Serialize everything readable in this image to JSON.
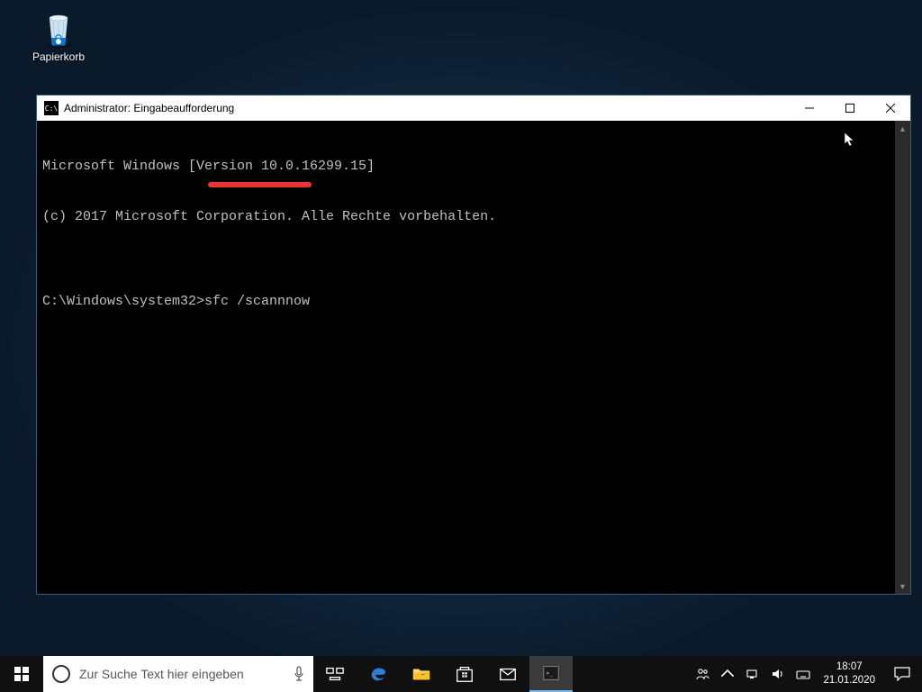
{
  "desktop": {
    "recycle_bin_label": "Papierkorb"
  },
  "cmd_window": {
    "title": "Administrator: Eingabeaufforderung",
    "lines": [
      "Microsoft Windows [Version 10.0.16299.15]",
      "(c) 2017 Microsoft Corporation. Alle Rechte vorbehalten.",
      "",
      "C:\\Windows\\system32>sfc /scannnow"
    ]
  },
  "taskbar": {
    "search_placeholder": "Zur Suche Text hier eingeben",
    "clock_time": "18:07",
    "clock_date": "21.01.2020"
  }
}
